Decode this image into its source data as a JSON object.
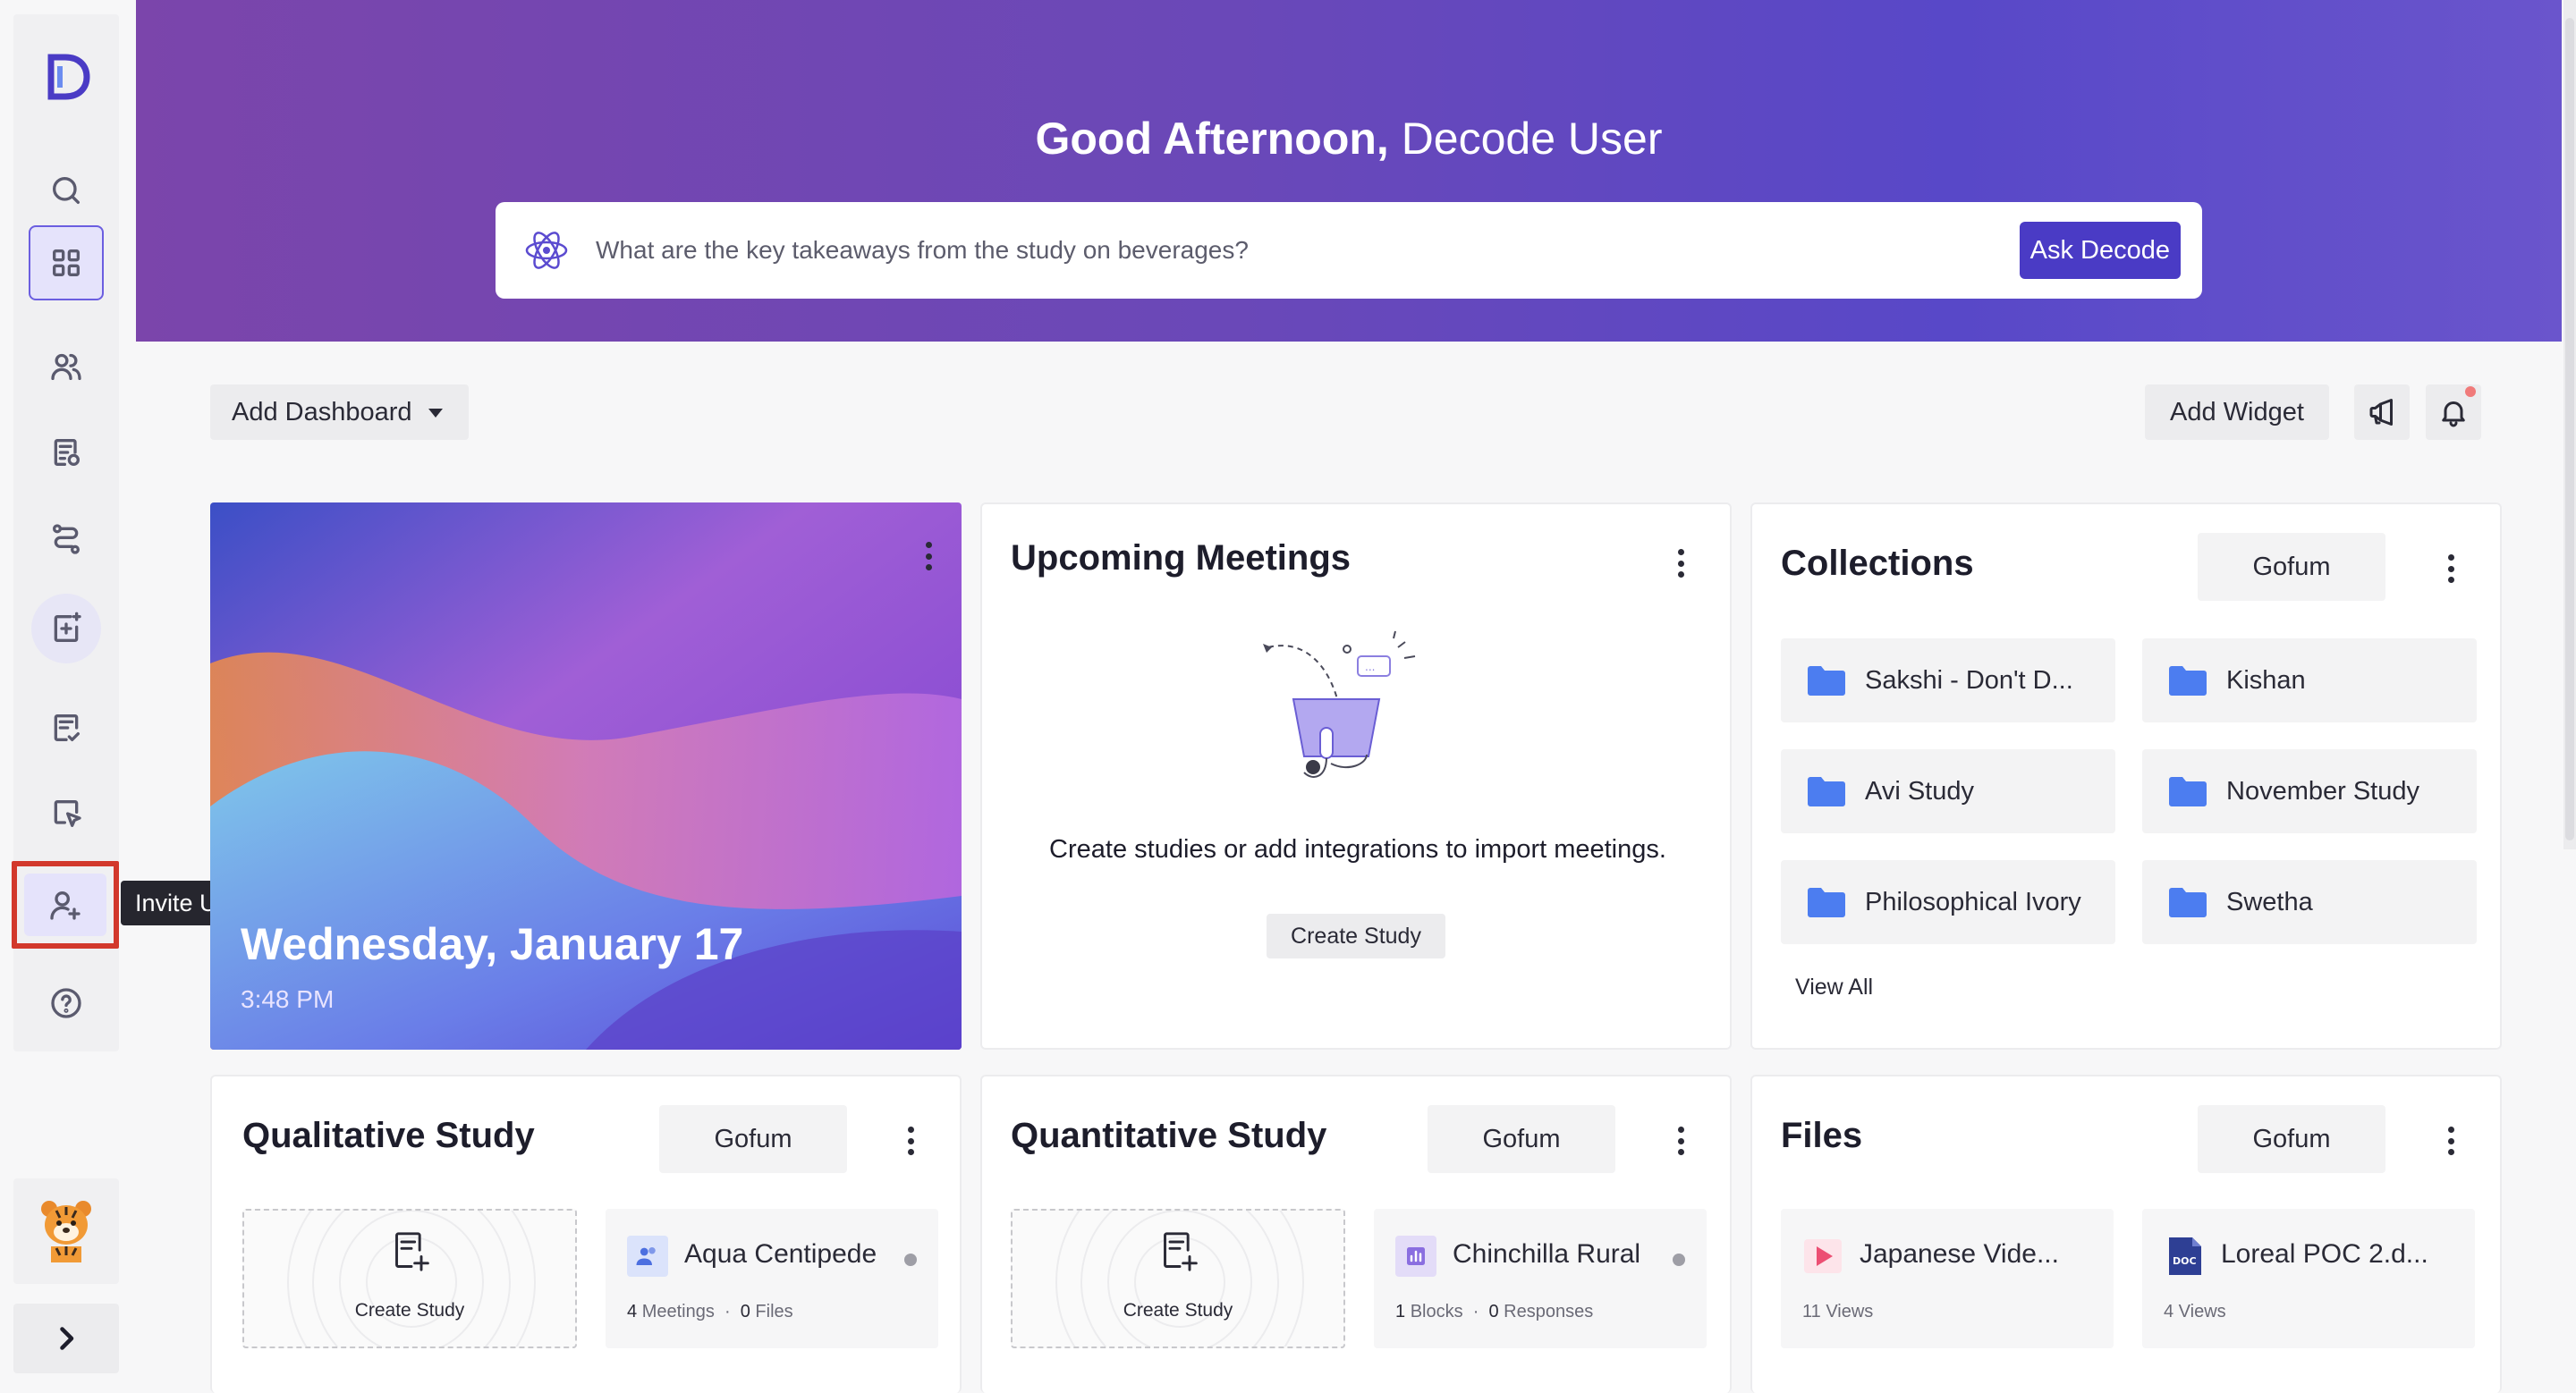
{
  "hero": {
    "greeting_bold": "Good Afternoon,",
    "greeting_user": "Decode User",
    "ask_placeholder": "What are the key takeaways from the study on beverages?",
    "ask_button": "Ask Decode"
  },
  "sidebar": {
    "logo_icon": "decode-logo-icon",
    "items": [
      {
        "icon": "search-icon"
      },
      {
        "icon": "dashboard-grid-icon"
      },
      {
        "icon": "users-icon"
      },
      {
        "icon": "document-list-icon"
      },
      {
        "icon": "workflow-icon"
      },
      {
        "icon": "add-study-icon"
      },
      {
        "icon": "checklist-icon"
      },
      {
        "icon": "cursor-click-icon"
      },
      {
        "icon": "invite-user-icon"
      },
      {
        "icon": "help-icon"
      }
    ],
    "tooltip": "Invite User",
    "expand_icon": "chevron-right-icon"
  },
  "toolbar": {
    "add_dashboard": "Add Dashboard",
    "add_widget": "Add Widget"
  },
  "image_card": {
    "date": "Wednesday, January 17",
    "time": "3:48 PM"
  },
  "meetings": {
    "title": "Upcoming Meetings",
    "empty_text": "Create studies or add integrations to import meetings.",
    "create_button": "Create Study"
  },
  "collections": {
    "title": "Collections",
    "filter": "Gofum",
    "items": [
      "Sakshi - Don't D...",
      "Kishan",
      "Avi Study",
      "November Study",
      "Philosophical Ivory",
      "Swetha"
    ],
    "view_all": "View All"
  },
  "qualitative": {
    "title": "Qualitative Study",
    "filter": "Gofum",
    "create_label": "Create Study",
    "item": {
      "name": "Aqua Centipede",
      "count1": "4",
      "label1": "Meetings",
      "count2": "0",
      "label2": "Files"
    }
  },
  "quantitative": {
    "title": "Quantitative Study",
    "filter": "Gofum",
    "create_label": "Create Study",
    "item": {
      "name": "Chinchilla Rural",
      "count1": "1",
      "label1": "Blocks",
      "count2": "0",
      "label2": "Responses"
    }
  },
  "files": {
    "title": "Files",
    "filter": "Gofum",
    "items": [
      {
        "name": "Japanese Vide...",
        "meta": "11 Views"
      },
      {
        "name": "Loreal POC 2.d...",
        "meta": "4 Views",
        "badge": "DOC"
      }
    ]
  },
  "colors": {
    "accent": "#4a3bc5",
    "hero_start": "#7b45ab",
    "hero_end": "#5848c8",
    "highlight": "#d2382c"
  }
}
